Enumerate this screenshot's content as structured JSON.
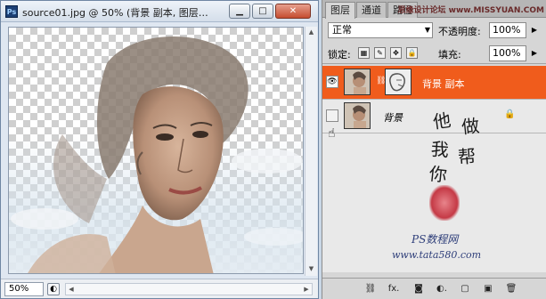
{
  "document_window": {
    "app_badge": "Ps",
    "title": "source01.jpg @ 50% (背景 副本, 图层…",
    "minimize": "▁",
    "maximize": "□",
    "close": "✕",
    "zoom": "50%"
  },
  "layers_panel": {
    "tabs": [
      {
        "label": "图层",
        "active": true
      },
      {
        "label": "通道",
        "active": false
      },
      {
        "label": "路径",
        "active": false
      }
    ],
    "top_watermark": "思缘设计论坛  www.MISSYUAN.COM",
    "blend_mode": "正常",
    "opacity_label": "不透明度:",
    "opacity_value": "100%",
    "lock_label": "锁定:",
    "fill_label": "填充:",
    "fill_value": "100%",
    "layers": [
      {
        "name": "背景 副本",
        "selected": true,
        "visible": true
      },
      {
        "name": "背景",
        "selected": false,
        "visible": false,
        "locked": true
      }
    ],
    "bottom_icons": [
      "link-icon",
      "fx-icon",
      "mask-icon",
      "adjustment-icon",
      "folder-icon",
      "new-layer-icon",
      "trash-icon"
    ],
    "bottom_glyphs": [
      "⛓",
      "fx.",
      "◙",
      "◐.",
      "▢",
      "▣",
      "🗑"
    ]
  },
  "handwriting": {
    "text": "他做我帮你",
    "footer1": "PS数程网",
    "footer2": "www.tata580.com"
  },
  "colors": {
    "selected_layer": "#f05c1c",
    "seal": "#c53a46"
  }
}
